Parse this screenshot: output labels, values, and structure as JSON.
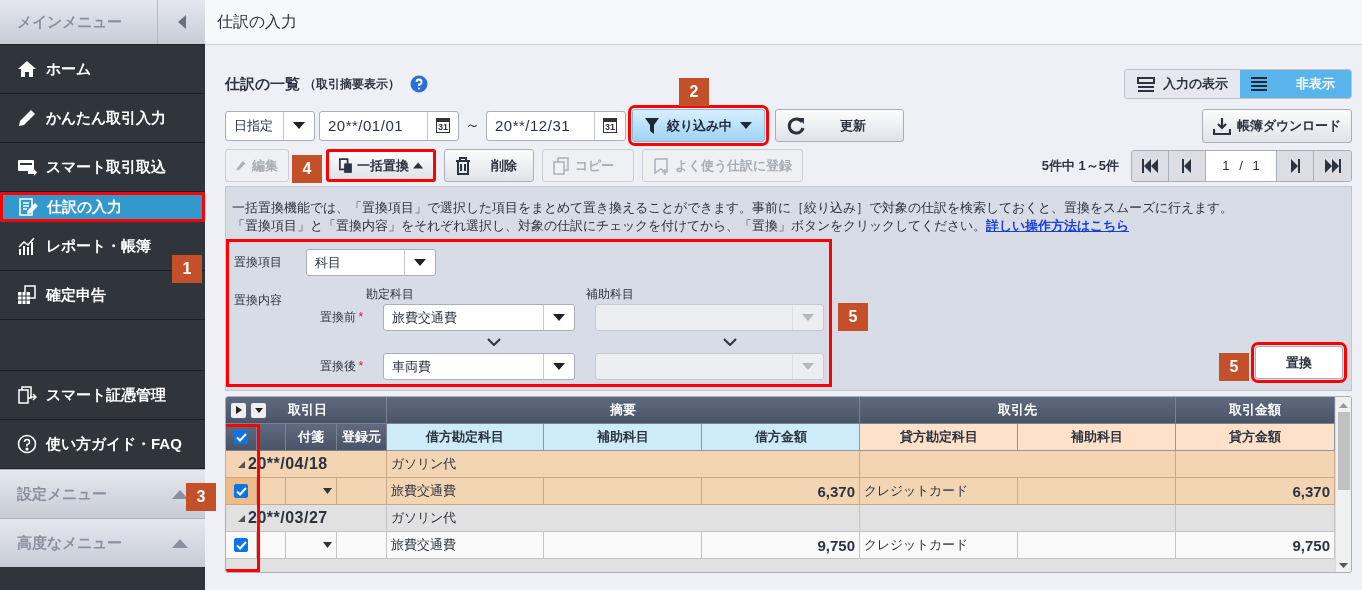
{
  "sidebar": {
    "title": "メインメニュー",
    "items": [
      {
        "label": "ホーム",
        "selected": false,
        "highlighted": false
      },
      {
        "label": "かんたん取引入力",
        "selected": false,
        "highlighted": false
      },
      {
        "label": "スマート取引取込",
        "selected": false,
        "highlighted": false
      },
      {
        "label": "仕訳の入力",
        "selected": true,
        "highlighted": true
      },
      {
        "label": "レポート・帳簿",
        "selected": false,
        "highlighted": false
      },
      {
        "label": "確定申告",
        "selected": false,
        "highlighted": false
      }
    ],
    "lower_items": [
      {
        "label": "スマート証憑管理",
        "selected": false,
        "highlighted": false
      },
      {
        "label": "使い方ガイド・FAQ",
        "selected": false,
        "highlighted": false
      }
    ],
    "sections": [
      {
        "label": "設定メニュー"
      },
      {
        "label": "高度なメニュー"
      }
    ]
  },
  "page_title": "仕訳の入力",
  "list": {
    "title": "仕訳の一覧",
    "subtitle": "（取引摘要表示）",
    "view_toggle": [
      {
        "label": "入力の表示",
        "selected": false
      },
      {
        "label": "非表示",
        "selected": true
      }
    ],
    "date_mode": "日指定",
    "date_from": {
      "value": "20**/01/01",
      "calendar_text": "31"
    },
    "date_separator": "～",
    "date_to": {
      "value": "20**/12/31",
      "calendar_text": "31"
    },
    "filter_button": {
      "label": "絞り込み中",
      "highlighted": true
    },
    "refresh_button": {
      "label": "更新"
    },
    "download_button": {
      "label": "帳簿ダウンロード"
    },
    "toolbar": [
      {
        "label": "編集",
        "disabled": true,
        "highlighted": false
      },
      {
        "label": "一括置換",
        "disabled": false,
        "highlighted": true
      },
      {
        "label": "削除",
        "disabled": false,
        "highlighted": false
      },
      {
        "label": "コピー",
        "disabled": true,
        "highlighted": false
      },
      {
        "label": "よく使う仕訳に登録",
        "disabled": true,
        "highlighted": false
      }
    ],
    "count_text": "5件中 1～5件",
    "page_text": "1 / 1"
  },
  "replace_panel": {
    "info": [
      "一括置換機能では、「置換項目」で選択した項目をまとめて置き換えることができます。事前に［絞り込み］で対象の仕訳を検索しておくと、置換をスムーズに行えます。",
      "「置換項目」と「置換内容」をそれぞれ選択し、対象の仕訳にチェックを付けてから、「置換」ボタンをクリックしてください。"
    ],
    "link": "詳しい操作方法はこちら",
    "form_highlighted": true,
    "item_label": "置換項目",
    "item_value": "科目",
    "content_label": "置換内容",
    "column_headers": [
      "勘定科目",
      "補助科目"
    ],
    "rows": [
      {
        "label": "置換前",
        "required": true,
        "account": "旅費交通費",
        "sub_disabled": true
      },
      {
        "label": "置換後",
        "required": true,
        "account": "車両費",
        "sub_disabled": true
      }
    ],
    "required_mark": "*",
    "replace_button": {
      "label": "置換",
      "highlighted": true
    }
  },
  "table": {
    "header_groups": [
      "取引日",
      "摘要",
      "取引先",
      "取引金額"
    ],
    "all_checked": true,
    "checkbox_column_highlighted": true,
    "columns": [
      "付箋",
      "登録元",
      "借方勘定科目",
      "補助科目",
      "借方金額",
      "貸方勘定科目",
      "補助科目",
      "貸方金額"
    ],
    "entries": [
      {
        "date": "20**/04/18",
        "summary": "ガソリン代",
        "selected": true,
        "checked": true,
        "debit_account": "旅費交通費",
        "debit_amount": "6,370",
        "credit_account": "クレジットカード",
        "credit_amount": "6,370"
      },
      {
        "date": "20**/03/27",
        "summary": "ガソリン代",
        "selected": false,
        "checked": true,
        "debit_account": "旅費交通費",
        "debit_amount": "9,750",
        "credit_account": "クレジットカード",
        "credit_amount": "9,750"
      }
    ]
  },
  "callouts": [
    "1",
    "2",
    "3",
    "4",
    "5",
    "5"
  ]
}
